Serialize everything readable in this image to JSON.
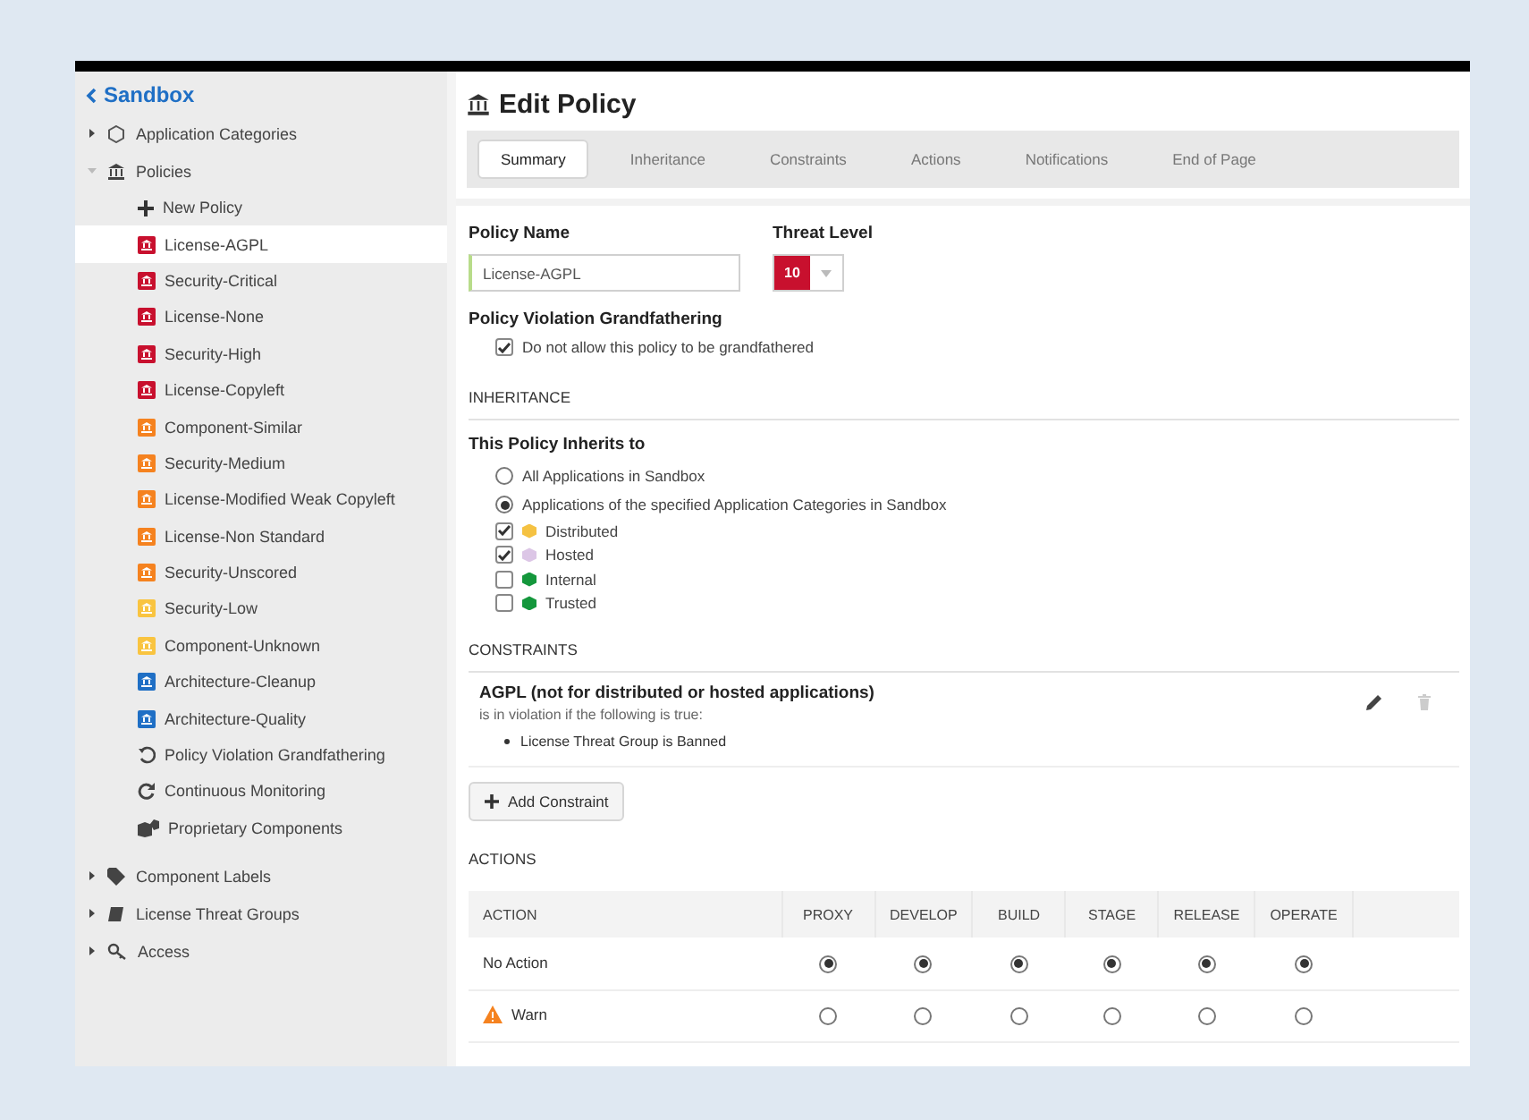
{
  "sidebar": {
    "back_link": "Sandbox",
    "items": [
      {
        "label": "Application Categories",
        "kind": "categories",
        "expanded": false
      },
      {
        "label": "Policies",
        "kind": "policies",
        "expanded": true,
        "children": [
          {
            "label": "New Policy",
            "kind": "new",
            "selected": false
          },
          {
            "label": "License-AGPL",
            "kind": "policy",
            "color": "#c8102e",
            "selected": true
          },
          {
            "label": "Security-Critical",
            "kind": "policy",
            "color": "#c8102e",
            "selected": false
          },
          {
            "label": "License-None",
            "kind": "policy",
            "color": "#c8102e",
            "selected": false
          },
          {
            "label": "Security-High",
            "kind": "policy",
            "color": "#c8102e",
            "selected": false
          },
          {
            "label": "License-Copyleft",
            "kind": "policy",
            "color": "#c8102e",
            "selected": false
          },
          {
            "label": "Component-Similar",
            "kind": "policy",
            "color": "#f5821f",
            "selected": false
          },
          {
            "label": "Security-Medium",
            "kind": "policy",
            "color": "#f5821f",
            "selected": false
          },
          {
            "label": "License-Modified Weak Copyleft",
            "kind": "policy",
            "color": "#f5821f",
            "selected": false
          },
          {
            "label": "License-Non Standard",
            "kind": "policy",
            "color": "#f5821f",
            "selected": false
          },
          {
            "label": "Security-Unscored",
            "kind": "policy",
            "color": "#f5821f",
            "selected": false
          },
          {
            "label": "Security-Low",
            "kind": "policy",
            "color": "#f9c440",
            "selected": false
          },
          {
            "label": "Component-Unknown",
            "kind": "policy",
            "color": "#f9c440",
            "selected": false
          },
          {
            "label": "Architecture-Cleanup",
            "kind": "policy",
            "color": "#1f6fc5",
            "selected": false
          },
          {
            "label": "Architecture-Quality",
            "kind": "policy",
            "color": "#1f6fc5",
            "selected": false
          },
          {
            "label": "Policy Violation Grandfathering",
            "kind": "grandfathering",
            "selected": false
          },
          {
            "label": "Continuous Monitoring",
            "kind": "monitoring",
            "selected": false
          },
          {
            "label": "Proprietary Components",
            "kind": "proprietary",
            "selected": false
          }
        ]
      },
      {
        "label": "Component Labels",
        "kind": "labels",
        "expanded": false
      },
      {
        "label": "License Threat Groups",
        "kind": "threat_groups",
        "expanded": false
      },
      {
        "label": "Access",
        "kind": "access",
        "expanded": false
      }
    ]
  },
  "title": "Edit Policy",
  "tabs": [
    {
      "label": "Summary",
      "selected": true
    },
    {
      "label": "Inheritance",
      "selected": false
    },
    {
      "label": "Constraints",
      "selected": false
    },
    {
      "label": "Actions",
      "selected": false
    },
    {
      "label": "Notifications",
      "selected": false
    },
    {
      "label": "End of Page",
      "selected": false
    }
  ],
  "policy_name": {
    "label": "Policy Name",
    "value": "License-AGPL"
  },
  "threat_level": {
    "label": "Threat Level",
    "value": "10"
  },
  "grandfathering": {
    "label": "Policy Violation Grandfathering",
    "option": {
      "label": "Do not allow this policy to be grandfathered",
      "checked": true
    }
  },
  "inheritance": {
    "heading": "INHERITANCE",
    "subheading": "This Policy Inherits to",
    "options": [
      {
        "label": "All Applications in Sandbox",
        "selected": false
      },
      {
        "label": "Applications of the specified Application Categories in Sandbox",
        "selected": true
      }
    ],
    "categories": [
      {
        "label": "Distributed",
        "checked": true,
        "color": "#f5c242"
      },
      {
        "label": "Hosted",
        "checked": true,
        "color": "#dcc6e6"
      },
      {
        "label": "Internal",
        "checked": false,
        "color": "#14973c"
      },
      {
        "label": "Trusted",
        "checked": false,
        "color": "#14973c"
      }
    ]
  },
  "constraints": {
    "heading": "CONSTRAINTS",
    "items": [
      {
        "title": "AGPL (not for distributed or hosted applications)",
        "subtitle": "is in violation if the following is true:",
        "conditions": [
          "License Threat Group is Banned"
        ]
      }
    ],
    "add_button": "Add Constraint"
  },
  "actions": {
    "heading": "ACTIONS",
    "columns": [
      "ACTION",
      "PROXY",
      "DEVELOP",
      "BUILD",
      "STAGE",
      "RELEASE",
      "OPERATE"
    ],
    "rows": [
      {
        "label": "No Action",
        "kind": "none",
        "cells": [
          {
            "selected": true
          },
          {
            "selected": true
          },
          {
            "selected": true
          },
          {
            "selected": true
          },
          {
            "selected": true
          },
          {
            "selected": true
          }
        ]
      },
      {
        "label": "Warn",
        "kind": "warn",
        "cells": [
          {
            "selected": false
          },
          {
            "selected": false
          },
          {
            "selected": false
          },
          {
            "selected": false
          },
          {
            "selected": false
          },
          {
            "selected": false
          }
        ]
      }
    ]
  }
}
